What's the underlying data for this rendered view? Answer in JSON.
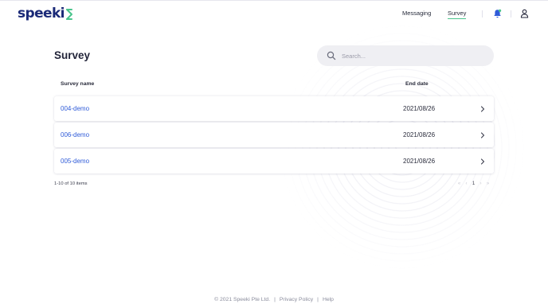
{
  "brand": {
    "logo_text": "speeki",
    "accent": "#4ac48c",
    "primary": "#1b2a78"
  },
  "nav": {
    "messaging_label": "Messaging",
    "survey_label": "Survey"
  },
  "header_icons": [
    "bell-icon",
    "user-icon"
  ],
  "page": {
    "title": "Survey"
  },
  "search": {
    "placeholder": "Search..."
  },
  "table": {
    "columns": {
      "name": "Survey name",
      "end_date": "End date"
    },
    "rows": [
      {
        "name": "004-demo",
        "end_date": "2021/08/26"
      },
      {
        "name": "006-demo",
        "end_date": "2021/08/26"
      },
      {
        "name": "005-demo",
        "end_date": "2021/08/26"
      }
    ]
  },
  "pagination": {
    "summary": "1-10 of 10 items",
    "first": "«",
    "prev": "‹",
    "current": "1",
    "next": "›",
    "last": "»"
  },
  "footer": {
    "copyright": "© 2021 Speeki Pte Ltd.",
    "separator": "|",
    "privacy": "Privacy Policy",
    "help": "Help"
  }
}
